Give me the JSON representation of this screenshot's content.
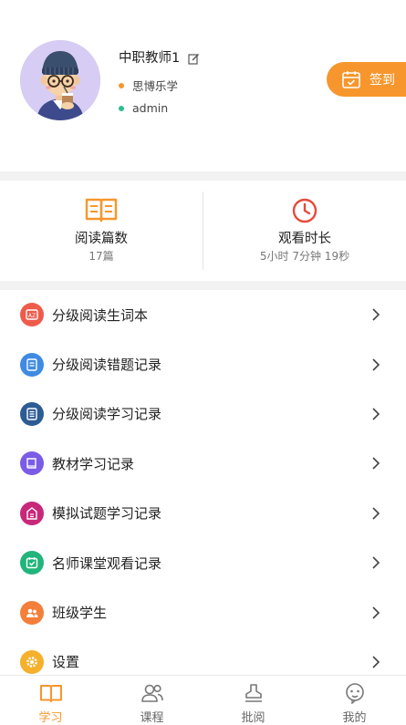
{
  "profile": {
    "name": "中职教师1",
    "school": "思博乐学",
    "username": "admin",
    "school_dot_color": "#f7962c",
    "user_dot_color": "#2bbf8a",
    "checkin_label": "签到"
  },
  "stats": [
    {
      "icon": "open-book-icon",
      "title": "阅读篇数",
      "value": "17篇"
    },
    {
      "icon": "clock-icon",
      "title": "观看时长",
      "value": "5小时 7分钟 19秒"
    }
  ],
  "menu": [
    {
      "label": "分级阅读生词本",
      "icon": "vocabulary-icon",
      "color": "#ef5b4b"
    },
    {
      "label": "分级阅读错题记录",
      "icon": "wrong-questions-icon",
      "color": "#3f8be3"
    },
    {
      "label": "分级阅读学习记录",
      "icon": "study-record-icon",
      "color": "#2d5b94"
    },
    {
      "label": "教材学习记录",
      "icon": "textbook-icon",
      "color": "#7b5ce6"
    },
    {
      "label": "模拟试题学习记录",
      "icon": "mock-exam-icon",
      "color": "#c8287a"
    },
    {
      "label": "名师课堂观看记录",
      "icon": "class-calendar-icon",
      "color": "#22b47b"
    },
    {
      "label": "班级学生",
      "icon": "students-icon",
      "color": "#f47f3a"
    },
    {
      "label": "设置",
      "icon": "settings-gear-icon",
      "color": "#f5b12c"
    }
  ],
  "tabs": [
    {
      "label": "学习",
      "icon": "book-tab-icon",
      "active": true
    },
    {
      "label": "课程",
      "icon": "course-tab-icon",
      "active": false
    },
    {
      "label": "批阅",
      "icon": "review-stamp-icon",
      "active": false
    },
    {
      "label": "我的",
      "icon": "profile-tab-icon",
      "active": false
    }
  ],
  "colors": {
    "accent": "#f7962c",
    "clock_red": "#e64a3b",
    "separator": "#f2f2f2"
  }
}
